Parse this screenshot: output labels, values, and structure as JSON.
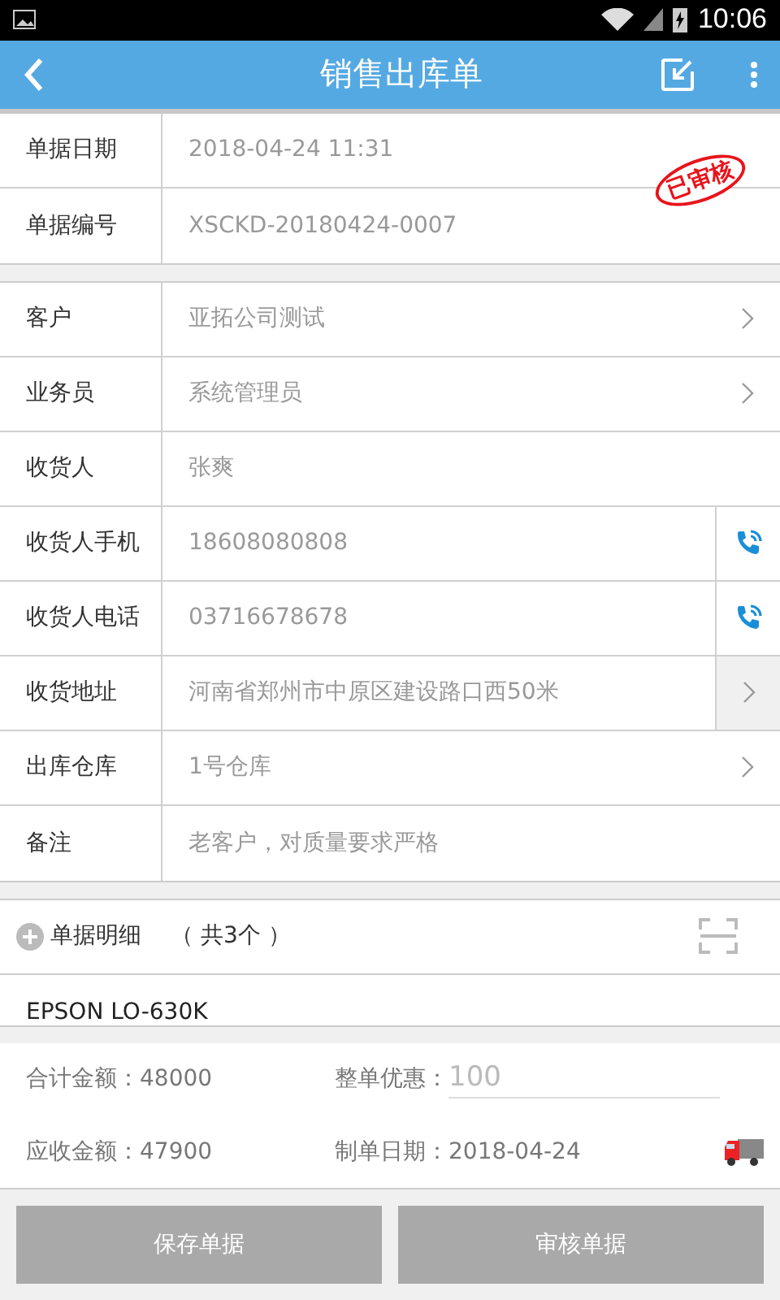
{
  "status_bar": {
    "time": "10:06"
  },
  "header": {
    "title": "销售出库单"
  },
  "stamp": {
    "text": "已审核"
  },
  "doc_fields": [
    {
      "label": "单据日期",
      "value": "2018-04-24 11:31"
    },
    {
      "label": "单据编号",
      "value": "XSCKD-20180424-0007"
    }
  ],
  "fields": [
    {
      "label": "客户",
      "value": "亚拓公司测试",
      "kind": "chevron"
    },
    {
      "label": "业务员",
      "value": "系统管理员",
      "kind": "chevron"
    },
    {
      "label": "收货人",
      "value": "张爽",
      "kind": "plain"
    },
    {
      "label": "收货人手机",
      "value": "18608080808",
      "kind": "phone"
    },
    {
      "label": "收货人电话",
      "value": "03716678678",
      "kind": "phone"
    },
    {
      "label": "收货地址",
      "value": "河南省郑州市中原区建设路口西50米",
      "kind": "boxed"
    },
    {
      "label": "出库仓库",
      "value": "1号仓库",
      "kind": "chevron"
    },
    {
      "label": "备注",
      "value": "老客户，对质量要求严格",
      "kind": "plain"
    }
  ],
  "details": {
    "title": "单据明细",
    "count": "（ 共3个 ）",
    "items": [
      "EPSON LO-630K"
    ]
  },
  "summary": {
    "total_label": "合计金额：",
    "total": "48000",
    "discount_label": "整单优惠：",
    "discount_placeholder": "100",
    "receivable_label": "应收金额：",
    "receivable": "47900",
    "date_label": "制单日期：",
    "date": "2018-04-24"
  },
  "buttons": [
    {
      "label": "保存单据",
      "disabled": true
    },
    {
      "label": "审核单据",
      "disabled": true
    }
  ]
}
